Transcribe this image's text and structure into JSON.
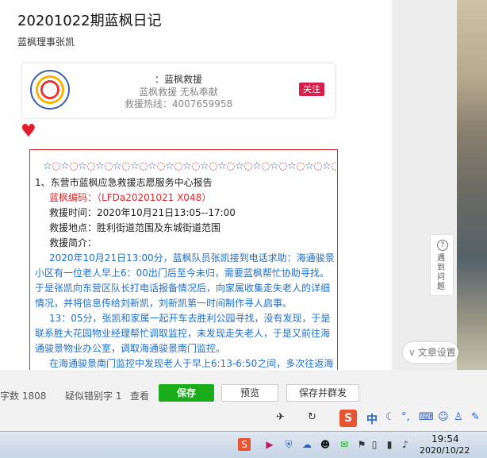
{
  "article": {
    "title": "20201022期蓝枫日记",
    "author": "蓝枫理事张凯"
  },
  "card": {
    "name": "：蓝枫救援",
    "slogan": "蓝枫救援  无私奉献",
    "hotline": "救援热线：4007659958",
    "follow_label": "关注"
  },
  "report": {
    "stars": [
      "☆",
      "◌",
      "☆",
      "◌",
      "☆",
      "◌",
      "☆",
      "◌",
      "☆",
      "◌",
      "☆",
      "◌",
      "☆",
      "◌",
      "☆",
      "◌",
      "☆",
      "◌",
      "☆",
      "◌",
      "☆",
      "◌",
      "☆",
      "◌",
      "☆",
      "◌",
      "☆",
      "◌",
      "☆",
      "◌",
      "☆",
      "◌",
      "☆",
      "◌",
      "☆",
      "◌",
      "☆",
      "◌",
      "☆",
      "◌"
    ],
    "heading": "1、东营市蓝枫应急救援志愿服务中心报告",
    "code_label": "蓝枫编码：",
    "code_value": "（LFDa20201021 X048）",
    "time": "救援时间：2020年10月21日13:05--17:00",
    "place": "救援地点：胜利街道范围及东城街道范围",
    "summary_label": "救援简介：",
    "para1": "2020年10月21日13:00分，蓝枫队员张凯接到电话求助：海通骏景小区有一位老人早上6：00出门后至今未归，需要蓝枫帮忙协助寻找。于是张凯向东营区队长打电话报备情况后，向家属收集走失老人的详细情况，并将信息传给刘新凯，刘新凯第一时间制作寻人启事。",
    "para2": "13：05分，张凯和家属一起开车去胜利公园寻找，没有发现，于是联系胜大花园物业经理帮忙调取监控，未发现走失老人，于是又前往海通骏景物业办公室，调取海通骏景南门监控。",
    "para3": "在海通骏景南门监控中发现老人于早上6:13-6:50之间，多次往返海"
  },
  "side": {
    "feedback_label": "遇到问题",
    "article_settings": "文章设置"
  },
  "bottom": {
    "word_count": "字数 1808",
    "typo": "疑似错别字 1",
    "check": "查看",
    "save": "保存",
    "preview": "预览",
    "publish": "保存并群发"
  },
  "ime": {
    "logo": "S",
    "lang": "中"
  },
  "taskbar": {
    "time": "19:54",
    "date": "2020/10/22"
  },
  "colors": {
    "save_green": "#1aad19",
    "follow_red": "#d6204b",
    "report_border": "#d62a2a",
    "report_blue": "#1f6fc8"
  }
}
